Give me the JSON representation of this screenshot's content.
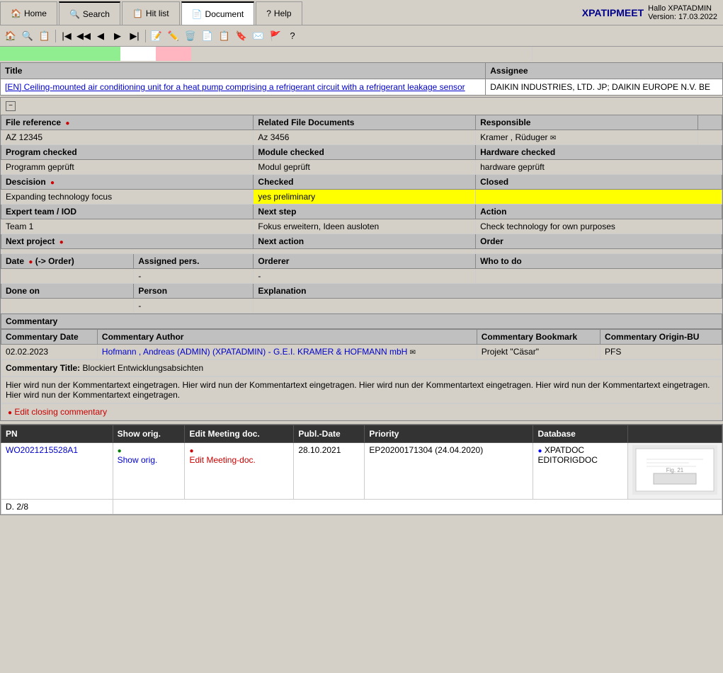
{
  "app": {
    "brand_name": "XPATIPMEET",
    "brand_version": "Version: 17.03.2022",
    "greeting": "Hallo XPATADMIN"
  },
  "nav": {
    "tabs": [
      {
        "id": "home",
        "label": "Home",
        "icon": "🏠",
        "active": false
      },
      {
        "id": "search",
        "label": "Search",
        "icon": "🔍",
        "active": false
      },
      {
        "id": "hitlist",
        "label": "Hit list",
        "icon": "📋",
        "active": false
      },
      {
        "id": "document",
        "label": "Document",
        "icon": "📄",
        "active": true
      },
      {
        "id": "help",
        "label": "Help",
        "icon": "?",
        "active": false
      }
    ]
  },
  "header_table": {
    "col1": "Title",
    "col2": "Assignee",
    "title_text": "[EN] Ceiling-mounted air conditioning unit for a heat pump comprising a refrigerant circuit with a refrigerant leakage sensor",
    "assignee_text": "DAIKIN INDUSTRIES, LTD. JP; DAIKIN EUROPE N.V. BE"
  },
  "section": {
    "fields": {
      "file_reference_label": "File reference",
      "related_docs_label": "Related File Documents",
      "responsible_label": "Responsible",
      "file_ref_value": "AZ 12345",
      "related_docs_value": "Az 3456",
      "responsible_value": "Kramer , Rüduger",
      "program_checked_label": "Program checked",
      "module_checked_label": "Module checked",
      "hardware_checked_label": "Hardware checked",
      "program_checked_value": "Programm geprüft",
      "module_checked_value": "Modul geprüft",
      "hardware_checked_value": "hardware geprüft",
      "decision_label": "Descision",
      "checked_label": "Checked",
      "closed_label": "Closed",
      "decision_value": "Expanding technology focus",
      "checked_value": "yes preliminary",
      "closed_value": "",
      "expert_team_label": "Expert team / IOD",
      "next_step_label": "Next step",
      "action_label": "Action",
      "expert_team_value": "Team 1",
      "next_step_value": "Fokus erweitern, Ideen ausloten",
      "action_value": "Check technology for own purposes",
      "next_project_label": "Next project",
      "next_action_label": "Next action",
      "order_label": "Order",
      "date_label": "Date",
      "date_sub": "(-> Order)",
      "assigned_pers_label": "Assigned pers.",
      "orderer_label": "Orderer",
      "who_to_do_label": "Who to do",
      "date_value": "",
      "assigned_pers_dash": "-",
      "orderer_dash": "-",
      "who_to_do_value": "",
      "done_on_label": "Done on",
      "person_label": "Person",
      "explanation_label": "Explanation",
      "done_on_value": "",
      "person_dash": "-",
      "explanation_value": ""
    },
    "commentary": {
      "label": "Commentary",
      "col_date": "Commentary Date",
      "col_author": "Commentary Author",
      "col_bookmark": "Commentary Bookmark",
      "col_origin": "Commentary Origin-BU",
      "date_value": "02.02.2023",
      "author_value": "Hofmann , Andreas (ADMIN) (XPATADMIN) - G.E.I. KRAMER & HOFMANN mbH",
      "bookmark_value": "Projekt \"Cäsar\"",
      "origin_value": "PFS",
      "title_label": "Commentary Title:",
      "title_value": "Blockiert Entwicklungsabsichten",
      "text_value": "Hier wird nun der Kommentartext eingetragen. Hier wird nun der Kommentartext eingetragen. Hier wird nun der Kommentartext eingetragen. Hier wird nun der Kommentartext eingetragen. Hier wird nun der Kommentartext eingetragen.",
      "edit_label": "Edit closing commentary"
    }
  },
  "bottom_table": {
    "col_pn": "PN",
    "col_show_orig": "Show orig.",
    "col_edit_meeting": "Edit Meeting doc.",
    "col_publ_date": "Publ.-Date",
    "col_priority": "Priority",
    "col_database": "Database",
    "col_thumbnail": "",
    "row": {
      "pn_value": "WO2021215528A1",
      "show_orig_value": "Show orig.",
      "edit_meeting_value": "Edit Meeting-doc.",
      "publ_date_value": "28.10.2021",
      "priority_value": "EP20200171304 (24.04.2020)",
      "database_value1": "XPATDOC",
      "database_value2": "EDITORIGDOC",
      "page_info": "D. 2/8"
    }
  },
  "toolbar": {
    "question_mark": "?"
  }
}
